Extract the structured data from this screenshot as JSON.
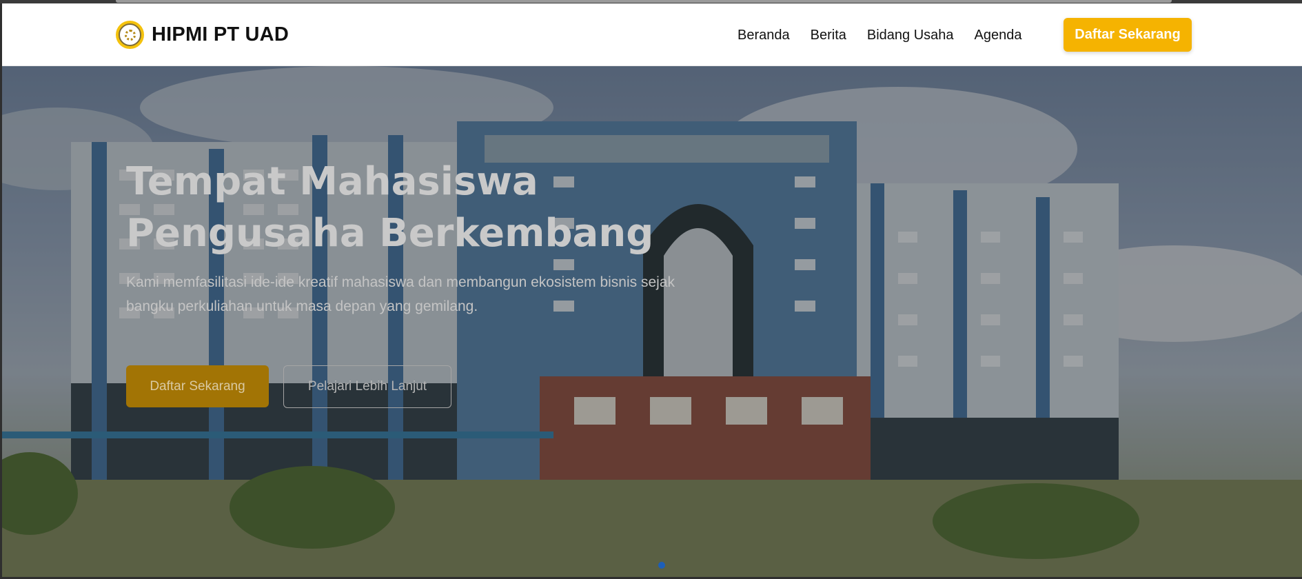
{
  "brand": {
    "name": "HIPMI PT UAD",
    "logo_icon": "hipmi-logo-icon",
    "logo_color": "#f4c20d"
  },
  "nav": {
    "links": [
      "Beranda",
      "Berita",
      "Bidang Usaha",
      "Agenda"
    ],
    "cta": "Daftar Sekarang"
  },
  "hero": {
    "title_line1": "Tempat Mahasiswa",
    "title_line2": "Pengusaha Berkembang",
    "description": "Kami memfasilitasi ide-ide kreatif mahasiswa dan membangun ekosistem bisnis sejak bangku perkuliahan untuk masa depan yang gemilang.",
    "primary_button": "Daftar Sekarang",
    "secondary_button": "Pelajari Lebih Lanjut",
    "background_image": "campus-building-photo",
    "carousel_active_index": 0
  },
  "colors": {
    "accent": "#f5b301",
    "dot": "#1d5fb8"
  }
}
